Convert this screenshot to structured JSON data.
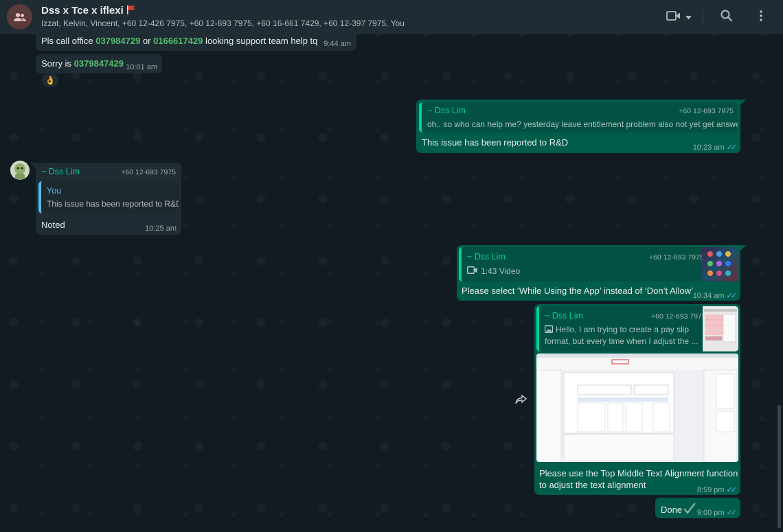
{
  "header": {
    "title": "Dss x Tce x iflexi",
    "participants": "Izzat, Kelvin, Vincent, +60 12-426 7975, +60 12-693 7975, +60 16-661 7429, +60 12-397 7975, You",
    "icons": [
      "group-avatar-icon",
      "video-call-icon",
      "chevron-down-icon",
      "search-icon",
      "menu-icon"
    ]
  },
  "messages": {
    "m1": {
      "prefix": "Pls call office ",
      "phone1": "037984729",
      "middle": " or ",
      "phone2": "0166617429",
      "suffix": " looking support team help tq",
      "time": "9:44 am"
    },
    "m2": {
      "prefix": "Sorry is ",
      "phone": "0379847429",
      "time": "10:01 am",
      "reaction": "👌"
    },
    "m3": {
      "quote_sender": "~ Dss Lim",
      "quote_number": "+60 12-693 7975",
      "quote_text": "oh.. so who can help me? yesterday leave entitlement problem also not yet get answer",
      "text": "This issue has been reported to R&D",
      "time": "10:23 am"
    },
    "m4": {
      "sender": "~ Dss Lim",
      "sender_number": "+60 12-693 7975",
      "quote_sender": "You",
      "quote_text": "This issue has been reported to R&D",
      "text": "Noted",
      "time": "10:25 am"
    },
    "m5": {
      "quote_sender": "~ Dss Lim",
      "quote_number": "+60 12-693 7975",
      "quote_text": "1:43 Video",
      "text": "Please select ‘While Using the App’ instead of ‘Don’t Allow’",
      "time": "10:34 am"
    },
    "m6": {
      "quote_sender": "~ Dss Lim",
      "quote_number": "+60 12-693 7975",
      "quote_line1": "Hello, I am trying to create a pay slip",
      "quote_line2": "format, but every time when I adjust the ...",
      "text_line1": "Please use the Top Middle Text Alignment function",
      "text_line2": "to adjust the text alignment",
      "time": "8:59 pm"
    },
    "m7": {
      "text": "Done",
      "time": "9:00 pm"
    }
  },
  "colors": {
    "incoming": "#202c33",
    "outgoing": "#005c4b",
    "accent_green": "#06cf9c",
    "link_green": "#53bd6f",
    "tick_blue": "#53bdeb"
  }
}
